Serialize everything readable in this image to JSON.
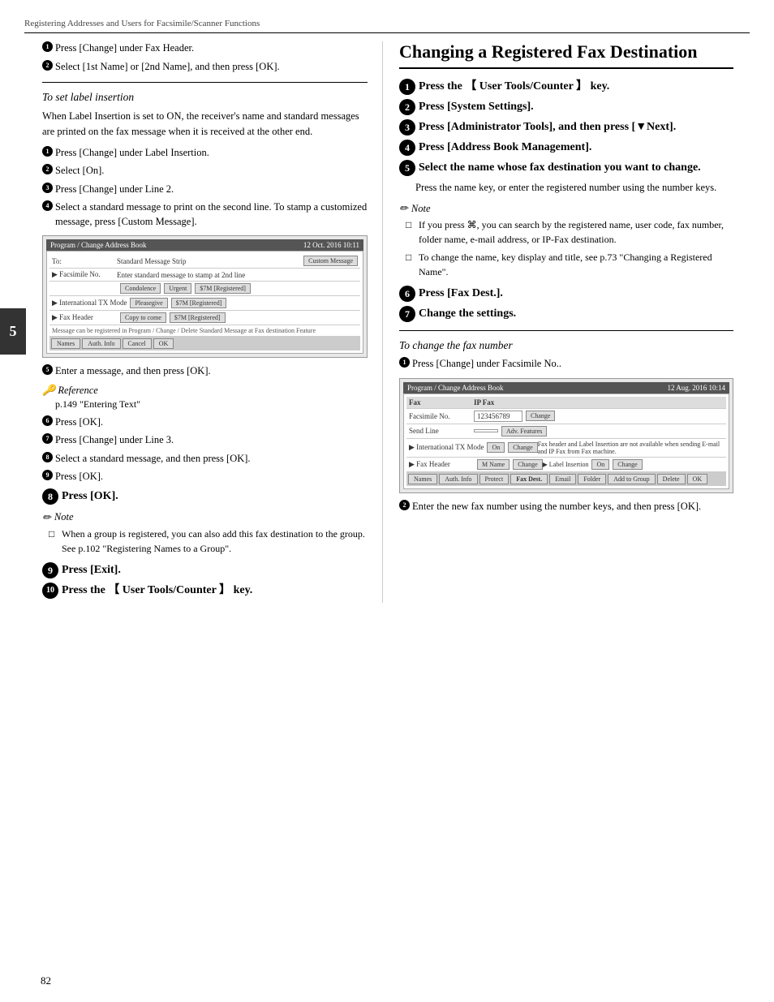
{
  "header": {
    "text": "Registering Addresses and Users for Facsimile/Scanner Functions"
  },
  "chapter": "5",
  "page_num": "82",
  "left_col": {
    "steps_top": [
      {
        "num": "1",
        "text": "Press [Change] under Fax Header."
      },
      {
        "num": "2",
        "text": "Select [1st Name] or [2nd Name], and then press [OK]."
      }
    ],
    "subsection_label_insertion": "To set label insertion",
    "label_insertion_body": "When Label Insertion is set to ON, the receiver's name and standard messages are printed on the fax message when it is received at the other end.",
    "label_steps": [
      {
        "num": "1",
        "text": "Press [Change] under Label Insertion."
      },
      {
        "num": "2",
        "text": "Select [On]."
      },
      {
        "num": "3",
        "text": "Press [Change] under Line 2."
      },
      {
        "num": "4",
        "text": "Select a standard message to print on the second line. To stamp a customized message, press [Custom Message]."
      }
    ],
    "step5_label": "Enter a message, and then press [OK].",
    "reference_title": "Reference",
    "reference_text": "p.149 \"Entering Text\"",
    "step6": "Press [OK].",
    "step7": "Press [Change] under Line 3.",
    "step8_title": "Select a standard message, and then press [OK].",
    "step9": "Press [OK].",
    "step8_large": "Press [OK].",
    "note_title": "Note",
    "note_items": [
      "When a group is registered, you can also add this fax destination to the group. See p.102 \"Registering Names to a Group\"."
    ],
    "step9_large": "Press [Exit].",
    "step10_large": "Press the 【 User Tools/Counter 】 key."
  },
  "right_col": {
    "section_title": "Changing a Registered Fax Destination",
    "steps": [
      {
        "num": "1",
        "text": "Press the 【 User Tools/Counter 】 key."
      },
      {
        "num": "2",
        "text": "Press [System Settings]."
      },
      {
        "num": "3",
        "text": "Press [Administrator Tools], and then press [▼Next]."
      },
      {
        "num": "4",
        "text": "Press [Address Book Management]."
      },
      {
        "num": "5",
        "text": "Select the name whose fax destination you want to change."
      }
    ],
    "step5_body": "Press the name key, or enter the registered number using the number keys.",
    "note_title": "Note",
    "note_items": [
      "If you press ⌘, you can search by the registered name, user code, fax number, folder name, e-mail address, or IP-Fax destination.",
      "To change the name, key display and title, see p.73 \"Changing a Registered Name\"."
    ],
    "step6": "Press [Fax Dest.].",
    "step7": "Change the settings.",
    "subsection_fax_number": "To change the fax number",
    "fax_steps": [
      {
        "num": "1",
        "text": "Press [Change] under Facsimile No.."
      }
    ],
    "fax_step2": "Enter the new fax number using the number keys, and then press [OK].",
    "screenshot": {
      "header": "Program / Change Address Book",
      "fax_label": "IP Fax",
      "fax_no_label": "Facsimile No.",
      "fax_no_value": "123456789",
      "send_line_label": "Send Line",
      "international_label": "International TX Mode",
      "fax_header_label": "Fax Header",
      "name_label": "M Name",
      "change_label": "Change",
      "nav_buttons": [
        "Names",
        "Auth. Info",
        "Protect",
        "Fax Dest.",
        "Email",
        "Folder",
        "Add to Group",
        "Delete",
        "OK"
      ]
    }
  }
}
